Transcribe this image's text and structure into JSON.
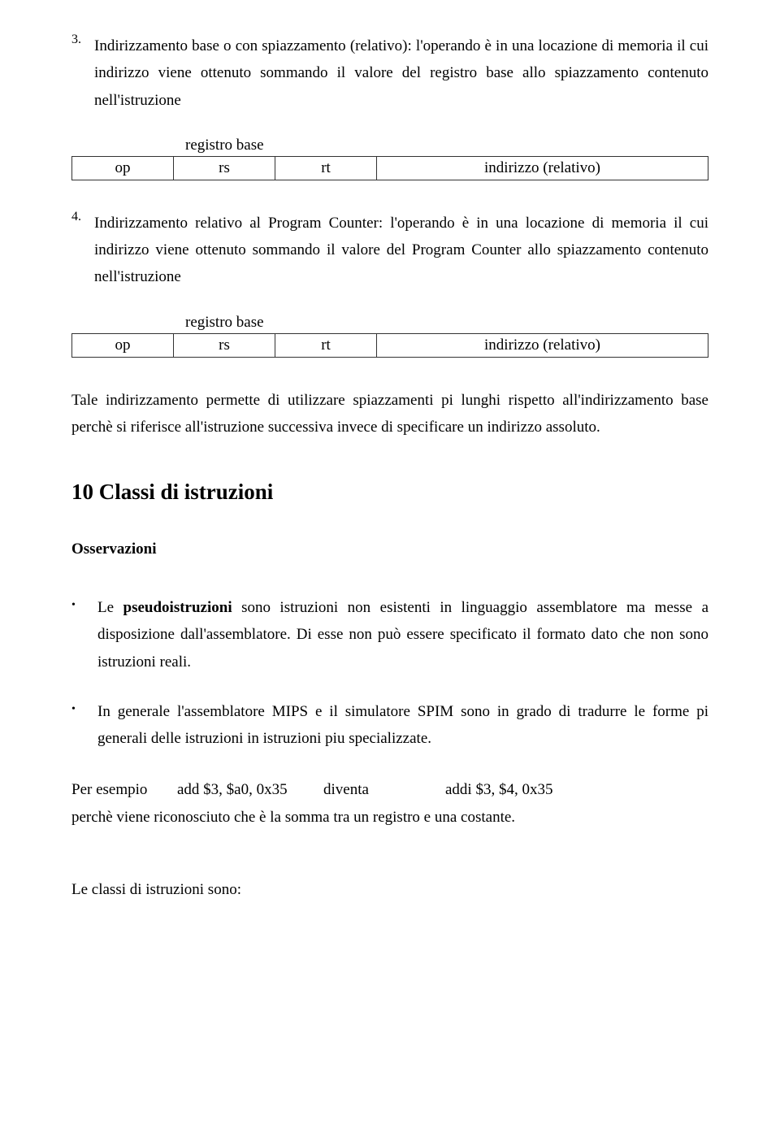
{
  "item3": {
    "marker": "3.",
    "text": "Indirizzamento base o con spiazzamento (relativo): l'operando è in una locazione di memoria il cui indirizzo viene ottenuto sommando il valore del registro base allo spiazzamento contenuto nell'istruzione"
  },
  "table1": {
    "label": "registro base",
    "op": "op",
    "rs": "rs",
    "rt": "rt",
    "addr": "indirizzo (relativo)"
  },
  "item4": {
    "marker": "4.",
    "text": "Indirizzamento relativo al Program Counter: l'operando è in una locazione di memoria il cui indirizzo viene ottenuto sommando il valore del Program Counter allo spiazzamento contenuto nell'istruzione"
  },
  "table2": {
    "label": "registro base",
    "op": "op",
    "rs": "rs",
    "rt": "rt",
    "addr": "indirizzo (relativo)"
  },
  "para_tale": "Tale indirizzamento permette di utilizzare spiazzamenti pi lunghi rispetto all'indirizzamento base perchè si riferisce all'istruzione successiva invece di specificare un indirizzo assoluto.",
  "heading10": "10 Classi di istruzioni",
  "osservazioni": "Osservazioni",
  "bullet1": {
    "pre": "Le ",
    "bold": "pseudoistruzioni",
    "post": " sono istruzioni non esistenti in linguaggio assemblatore ma messe a disposizione dall'assemblatore. Di esse non può essere specificato il formato dato che non sono istruzioni reali."
  },
  "bullet2": "In generale l'assemblatore MIPS e il simulatore SPIM sono in grado di tradurre le forme pi generali delle istruzioni in istruzioni piu specializzate.",
  "example": {
    "label": "Per esempio",
    "lhs": "add $3, $a0, 0x35",
    "become": "diventa",
    "rhs": "addi $3, $4, 0x35"
  },
  "perche": "perchè viene riconosciuto che è la somma tra un registro e una costante.",
  "final": "Le classi di istruzioni sono:"
}
